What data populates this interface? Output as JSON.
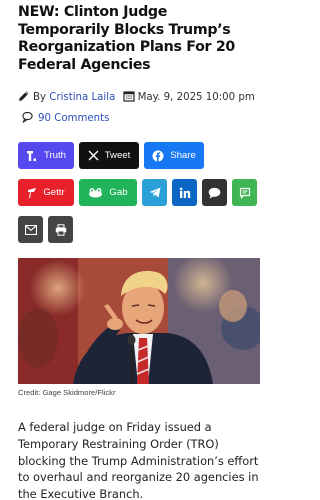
{
  "article": {
    "headline": "NEW: Clinton Judge Temporarily Blocks Trump’s Reorganization Plans For 20 Federal Agencies",
    "by_prefix": "By",
    "author": "Cristina Laila",
    "date": "May. 9, 2025 10:00 pm",
    "comments": "90 Comments",
    "image_credit": "Credit: Gage Skidmore/Flickr",
    "body": "A federal judge on Friday issued a Temporary Restraining Order (TRO) blocking the Trump Administration’s effort to overhaul and reorganize 20 agencies in the Executive Branch."
  },
  "share": {
    "truth": "Truth",
    "tweet": "Tweet",
    "facebook": "Share",
    "gettr": "Gettr",
    "gab": "Gab"
  },
  "colors": {
    "truth": "#5448ee",
    "tweet": "#111111",
    "facebook": "#1877f2",
    "gettr": "#e8202a",
    "gab": "#21b35a",
    "telegram": "#2a9fd8",
    "linkedin": "#0a66c2",
    "sms": "#333333",
    "message": "#3fb553",
    "email": "#444444",
    "print": "#444444"
  }
}
